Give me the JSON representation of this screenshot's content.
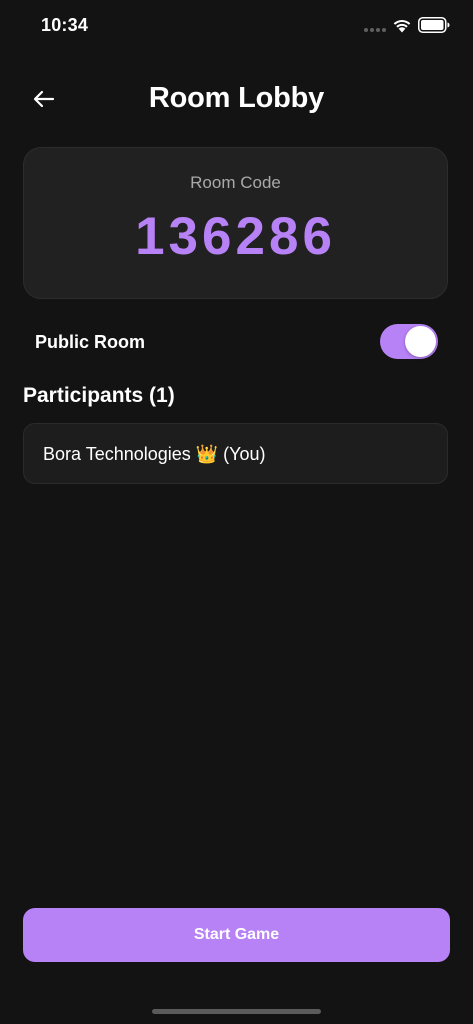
{
  "status_bar": {
    "time": "10:34",
    "wifi_icon": "wifi-icon",
    "battery_icon": "battery-icon",
    "signal_icon": "signal-dots-icon"
  },
  "header": {
    "back_icon": "arrow-left-icon",
    "title": "Room Lobby"
  },
  "room_card": {
    "label": "Room Code",
    "code": "136286"
  },
  "public_room": {
    "label": "Public Room",
    "enabled": true
  },
  "participants": {
    "heading": "Participants (1)",
    "items": [
      {
        "name": "Bora Technologies 👑 (You)"
      }
    ]
  },
  "footer": {
    "start_label": "Start Game"
  },
  "colors": {
    "background": "#131313",
    "card": "#212121",
    "accent": "#b882f7",
    "muted_text": "#a9a9a9"
  }
}
